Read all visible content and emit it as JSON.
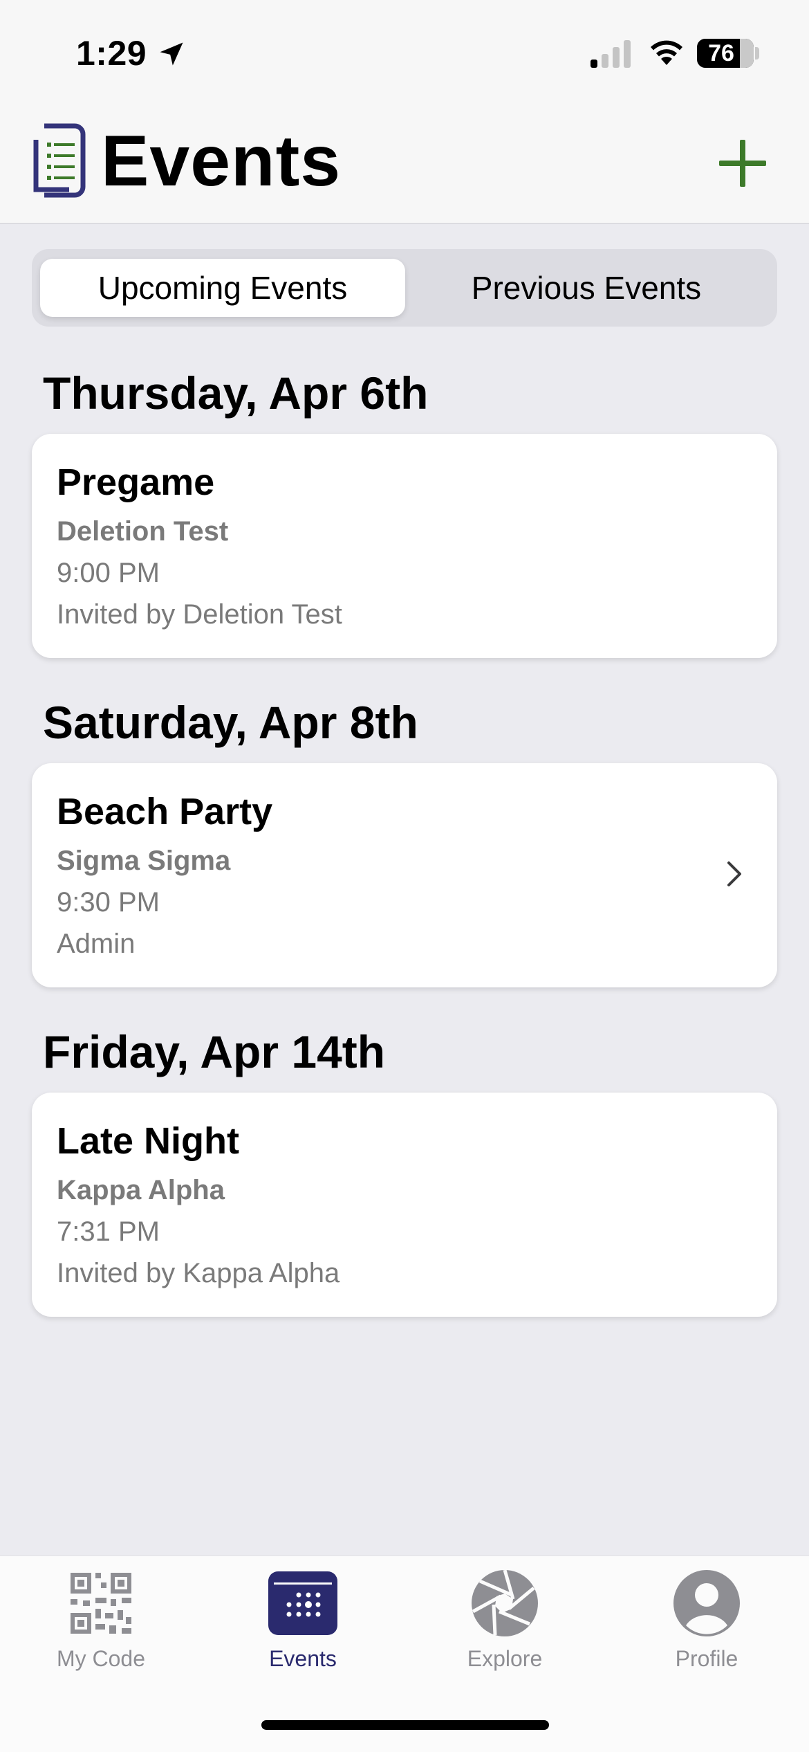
{
  "status_bar": {
    "time": "1:29",
    "battery": "76",
    "icons": [
      "location-arrow-icon",
      "cellular-signal-icon",
      "wifi-icon",
      "battery-icon"
    ]
  },
  "header": {
    "title": "Events",
    "add_icon": "plus-icon",
    "accent_color": "#3d7a2a",
    "brand_color": "#34347a"
  },
  "segments": {
    "upcoming_label": "Upcoming Events",
    "previous_label": "Previous Events",
    "selected": "Upcoming Events"
  },
  "sections": [
    {
      "date": "Thursday, Apr 6th",
      "event": {
        "title": "Pregame",
        "host": "Deletion Test",
        "time": "9:00 PM",
        "subtitle": "Invited by Deletion Test",
        "has_chevron": false
      }
    },
    {
      "date": "Saturday, Apr 8th",
      "event": {
        "title": "Beach Party",
        "host": "Sigma Sigma",
        "time": "9:30 PM",
        "subtitle": "Admin",
        "has_chevron": true
      }
    },
    {
      "date": "Friday, Apr 14th",
      "event": {
        "title": "Late Night",
        "host": "Kappa Alpha",
        "time": "7:31 PM",
        "subtitle": "Invited by Kappa Alpha",
        "has_chevron": false
      }
    }
  ],
  "tab_bar": {
    "tabs": [
      {
        "label": "My Code",
        "icon": "qr-code-icon"
      },
      {
        "label": "Events",
        "icon": "calendar-icon",
        "active": true
      },
      {
        "label": "Explore",
        "icon": "aperture-icon"
      },
      {
        "label": "Profile",
        "icon": "person-icon"
      }
    ]
  }
}
